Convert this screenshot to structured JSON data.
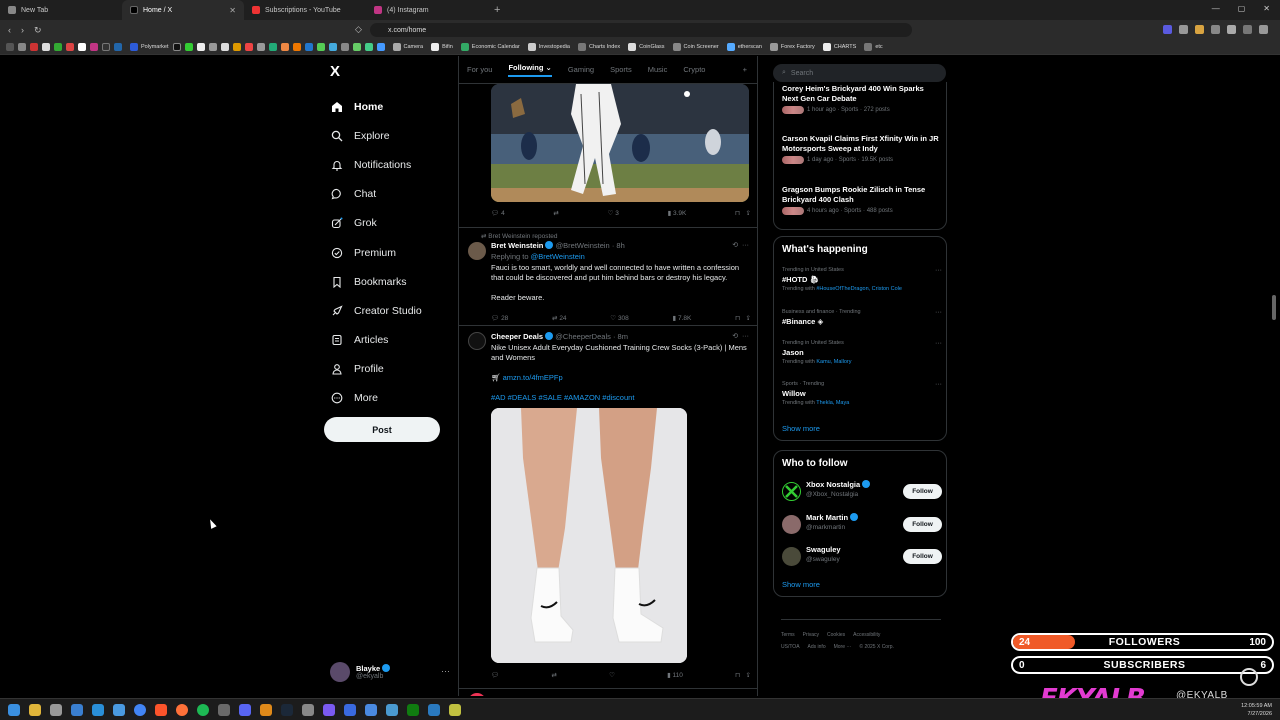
{
  "browser": {
    "tabs": [
      {
        "title": "New Tab",
        "active": false
      },
      {
        "title": "Home / X",
        "active": true
      },
      {
        "title": "Subscriptions - YouTube",
        "active": false
      },
      {
        "title": "(4) Instagram",
        "active": false
      }
    ],
    "url": "x.com/home",
    "bookmarks": [
      "Polymarket",
      "Camera",
      "Bifin",
      "Economic Calendar",
      "Investopedia",
      "Charts Index",
      "CoinGlass",
      "Coin Screener",
      "etherscan",
      "Forex Factory",
      "CHARTS",
      "etc"
    ]
  },
  "sidebar": {
    "logo": "X",
    "items": [
      {
        "label": "Home",
        "icon": "home-icon"
      },
      {
        "label": "Explore",
        "icon": "search-icon"
      },
      {
        "label": "Notifications",
        "icon": "bell-icon"
      },
      {
        "label": "Chat",
        "icon": "chat-icon"
      },
      {
        "label": "Grok",
        "icon": "grok-icon"
      },
      {
        "label": "Premium",
        "icon": "premium-icon"
      },
      {
        "label": "Bookmarks",
        "icon": "bookmark-icon"
      },
      {
        "label": "Creator Studio",
        "icon": "rocket-icon"
      },
      {
        "label": "Articles",
        "icon": "article-icon"
      },
      {
        "label": "Profile",
        "icon": "person-icon"
      },
      {
        "label": "More",
        "icon": "more-icon"
      }
    ],
    "post_label": "Post",
    "account": {
      "name": "Blayke",
      "handle": "@ekyalb"
    }
  },
  "feed": {
    "tabs": [
      "For you",
      "Following",
      "Gaming",
      "Sports",
      "Music",
      "Crypto"
    ],
    "first_actions": {
      "replies": "4",
      "reposts": "",
      "likes": "3",
      "views": "3.9K"
    },
    "tweet1": {
      "repost_by": "Bret Weinstein reposted",
      "name": "Bret Weinstein",
      "handle": "@BretWeinstein",
      "time": "· 8h",
      "replying": "Replying to",
      "replying_handle": "@BretWeinstein",
      "text": "Fauci is too smart, worldly and well connected to have written a confession that could be discovered and put him behind bars or destroy his legacy.",
      "text2": "Reader beware.",
      "replies": "28",
      "reposts": "24",
      "likes": "308",
      "views": "7.8K"
    },
    "tweet2": {
      "name": "Cheeper Deals",
      "handle": "@CheeperDeals",
      "time": "· 8m",
      "text": "Nike Unisex Adult Everyday Cushioned Training Crew Socks (3-Pack) | Mens and Womens",
      "link": "amzn.to/4fmEPFp",
      "tags": "#AD #DEALS #SALE #AMAZON #discount",
      "replies": "",
      "reposts": "",
      "likes": "",
      "views": "110"
    }
  },
  "right": {
    "search_placeholder": "Search",
    "news": [
      {
        "title": "Corey Heim's Brickyard 400 Win Sparks Next Gen Car Debate",
        "meta": "1 hour ago · Sports · 272 posts"
      },
      {
        "title": "Carson Kvapil Claims First Xfinity Win in JR Motorsports Sweep at Indy",
        "meta": "1 day ago · Sports · 19.5K posts"
      },
      {
        "title": "Gragson Bumps Rookie Zilisch in Tense Brickyard 400 Clash",
        "meta": "4 hours ago · Sports · 488 posts"
      }
    ],
    "happening_title": "What's happening",
    "trends": [
      {
        "context": "Trending in United States",
        "name": "#HOTD",
        "with_label": "Trending with",
        "with": "#HouseOfTheDragon, Criston Cole"
      },
      {
        "context": "Business and finance · Trending",
        "name": "#Binance",
        "with_label": "",
        "with": ""
      },
      {
        "context": "Trending in United States",
        "name": "Jason",
        "with_label": "Trending with",
        "with": "Kamu, Mallory"
      },
      {
        "context": "Sports · Trending",
        "name": "Willow",
        "with_label": "Trending with",
        "with": "Thekla, Maya"
      }
    ],
    "show_more": "Show more",
    "wtf_title": "Who to follow",
    "follow_label": "Follow",
    "who_to_follow": [
      {
        "name": "Xbox Nostalgia",
        "handle": "@Xbox_Nostalgia",
        "verified": true
      },
      {
        "name": "Mark Martin",
        "handle": "@markmartin",
        "verified": true
      },
      {
        "name": "Swaguley",
        "handle": "@swaguley",
        "verified": false
      }
    ],
    "footer": [
      "Terms",
      "Privacy",
      "Cookies",
      "Accessibility",
      "US/TOA",
      "Ads info",
      "More ···",
      "© 2025 X Corp."
    ]
  },
  "overlay": {
    "followers": {
      "count": "24",
      "label": "FOLLOWERS",
      "goal": "100",
      "progress": 0.24
    },
    "subscribers": {
      "count": "0",
      "label": "SUBSCRIBERS",
      "goal": "6",
      "progress": 0.0
    },
    "brand": "EKYALB",
    "handle": "@EKYALB"
  },
  "taskbar": {
    "time": "12:05:59 AM",
    "date": "7/27/2026"
  }
}
